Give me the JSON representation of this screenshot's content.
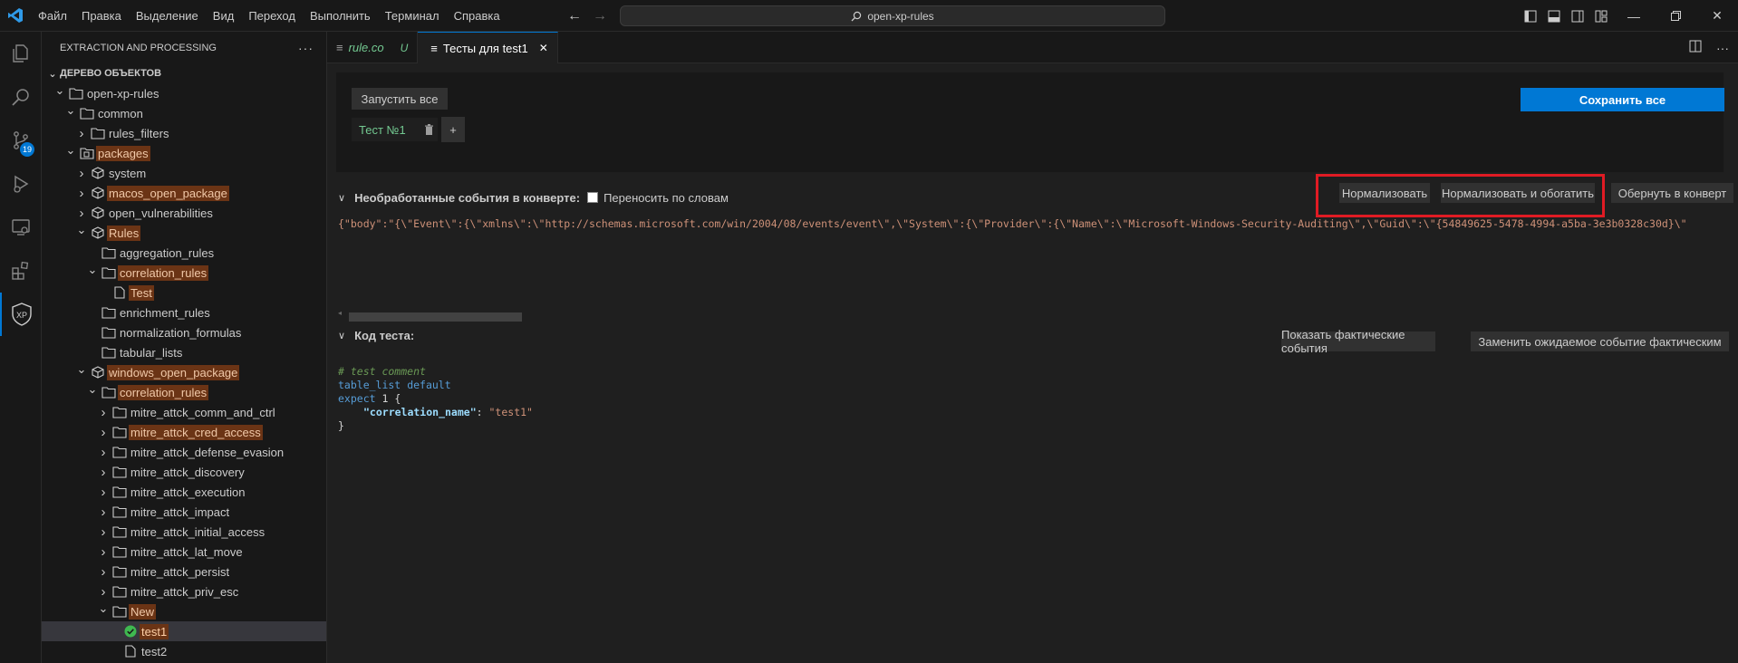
{
  "menu": [
    "Файл",
    "Правка",
    "Выделение",
    "Вид",
    "Переход",
    "Выполнить",
    "Терминал",
    "Справка"
  ],
  "search": {
    "text": "open-xp-rules"
  },
  "activity": {
    "scm_badge": "19",
    "xp_label": "XP"
  },
  "sidebar": {
    "title": "EXTRACTION AND PROCESSING",
    "more": "···",
    "section": "ДЕРЕВО ОБЪЕКТОВ",
    "tree": [
      {
        "label": "open-xp-rules",
        "level": 0,
        "twisty": "open",
        "icon": "folder",
        "hl": false
      },
      {
        "label": "common",
        "level": 1,
        "twisty": "open",
        "icon": "folder",
        "hl": false
      },
      {
        "label": "rules_filters",
        "level": 2,
        "twisty": "closed",
        "icon": "folder",
        "hl": false
      },
      {
        "label": "packages",
        "level": 1,
        "twisty": "open",
        "icon": "package-folder",
        "hl": true
      },
      {
        "label": "system",
        "level": 2,
        "twisty": "closed",
        "icon": "package",
        "hl": false
      },
      {
        "label": "macos_open_package",
        "level": 2,
        "twisty": "closed",
        "icon": "package",
        "hl": true
      },
      {
        "label": "open_vulnerabilities",
        "level": 2,
        "twisty": "closed",
        "icon": "package",
        "hl": false
      },
      {
        "label": "Rules",
        "level": 2,
        "twisty": "open",
        "icon": "package",
        "hl": true
      },
      {
        "label": "aggregation_rules",
        "level": 3,
        "twisty": "none",
        "icon": "folder",
        "hl": false
      },
      {
        "label": "correlation_rules",
        "level": 3,
        "twisty": "open",
        "icon": "folder",
        "hl": true
      },
      {
        "label": "Test",
        "level": 4,
        "twisty": "none",
        "icon": "file",
        "hl": true
      },
      {
        "label": "enrichment_rules",
        "level": 3,
        "twisty": "none",
        "icon": "folder",
        "hl": false
      },
      {
        "label": "normalization_formulas",
        "level": 3,
        "twisty": "none",
        "icon": "folder",
        "hl": false
      },
      {
        "label": "tabular_lists",
        "level": 3,
        "twisty": "none",
        "icon": "folder",
        "hl": false
      },
      {
        "label": "windows_open_package",
        "level": 2,
        "twisty": "open",
        "icon": "package",
        "hl": true
      },
      {
        "label": "correlation_rules",
        "level": 3,
        "twisty": "open",
        "icon": "folder",
        "hl": true
      },
      {
        "label": "mitre_attck_comm_and_ctrl",
        "level": 4,
        "twisty": "closed",
        "icon": "folder",
        "hl": false
      },
      {
        "label": "mitre_attck_cred_access",
        "level": 4,
        "twisty": "closed",
        "icon": "folder",
        "hl": true
      },
      {
        "label": "mitre_attck_defense_evasion",
        "level": 4,
        "twisty": "closed",
        "icon": "folder",
        "hl": false
      },
      {
        "label": "mitre_attck_discovery",
        "level": 4,
        "twisty": "closed",
        "icon": "folder",
        "hl": false
      },
      {
        "label": "mitre_attck_execution",
        "level": 4,
        "twisty": "closed",
        "icon": "folder",
        "hl": false
      },
      {
        "label": "mitre_attck_impact",
        "level": 4,
        "twisty": "closed",
        "icon": "folder",
        "hl": false
      },
      {
        "label": "mitre_attck_initial_access",
        "level": 4,
        "twisty": "closed",
        "icon": "folder",
        "hl": false
      },
      {
        "label": "mitre_attck_lat_move",
        "level": 4,
        "twisty": "closed",
        "icon": "folder",
        "hl": false
      },
      {
        "label": "mitre_attck_persist",
        "level": 4,
        "twisty": "closed",
        "icon": "folder",
        "hl": false
      },
      {
        "label": "mitre_attck_priv_esc",
        "level": 4,
        "twisty": "closed",
        "icon": "folder",
        "hl": false
      },
      {
        "label": "New",
        "level": 4,
        "twisty": "open",
        "icon": "folder",
        "hl": true
      },
      {
        "label": "test1",
        "level": 5,
        "twisty": "none",
        "icon": "check",
        "hl": true,
        "selected": true
      },
      {
        "label": "test2",
        "level": 5,
        "twisty": "none",
        "icon": "file",
        "hl": false
      }
    ]
  },
  "tabs": [
    {
      "label": "rule.co",
      "modified": "U",
      "active": false
    },
    {
      "label": "Тесты для test1",
      "active": true,
      "close": "✕"
    }
  ],
  "editor": {
    "run_all": "Запустить все",
    "save_all": "Сохранить все",
    "test_name": "Тест №1",
    "add": "+",
    "raw_section": {
      "title": "Необработанные события в конверте:",
      "wrap_label": "Переносить по словам",
      "buttons": [
        "Нормализовать",
        "Нормализовать и обогатить",
        "Обернуть в конверт"
      ]
    },
    "raw_json": "{\"body\":\"{\\\"Event\\\":{\\\"xmlns\\\":\\\"http://schemas.microsoft.com/win/2004/08/events/event\\\",\\\"System\\\":{\\\"Provider\\\":{\\\"Name\\\":\\\"Microsoft-Windows-Security-Auditing\\\",\\\"Guid\\\":\\\"{54849625-5478-4994-a5ba-3e3b0328c30d}\\\"",
    "code_section": {
      "title": "Код теста:",
      "buttons": [
        "Показать фактические события",
        "Заменить ожидаемое событие фактическим"
      ]
    },
    "code": {
      "comment": "# test comment",
      "kw_table_list": "table_list",
      "kw_default": "default",
      "kw_expect": "expect",
      "num": "1",
      "open_brace": "{",
      "key": "\"correlation_name\"",
      "colon": ":",
      "value": "\"test1\"",
      "close_brace": "}"
    }
  },
  "colors": {
    "accent": "#0078d4",
    "highlight_box": "#e01b24",
    "git_added": "#73c991"
  }
}
